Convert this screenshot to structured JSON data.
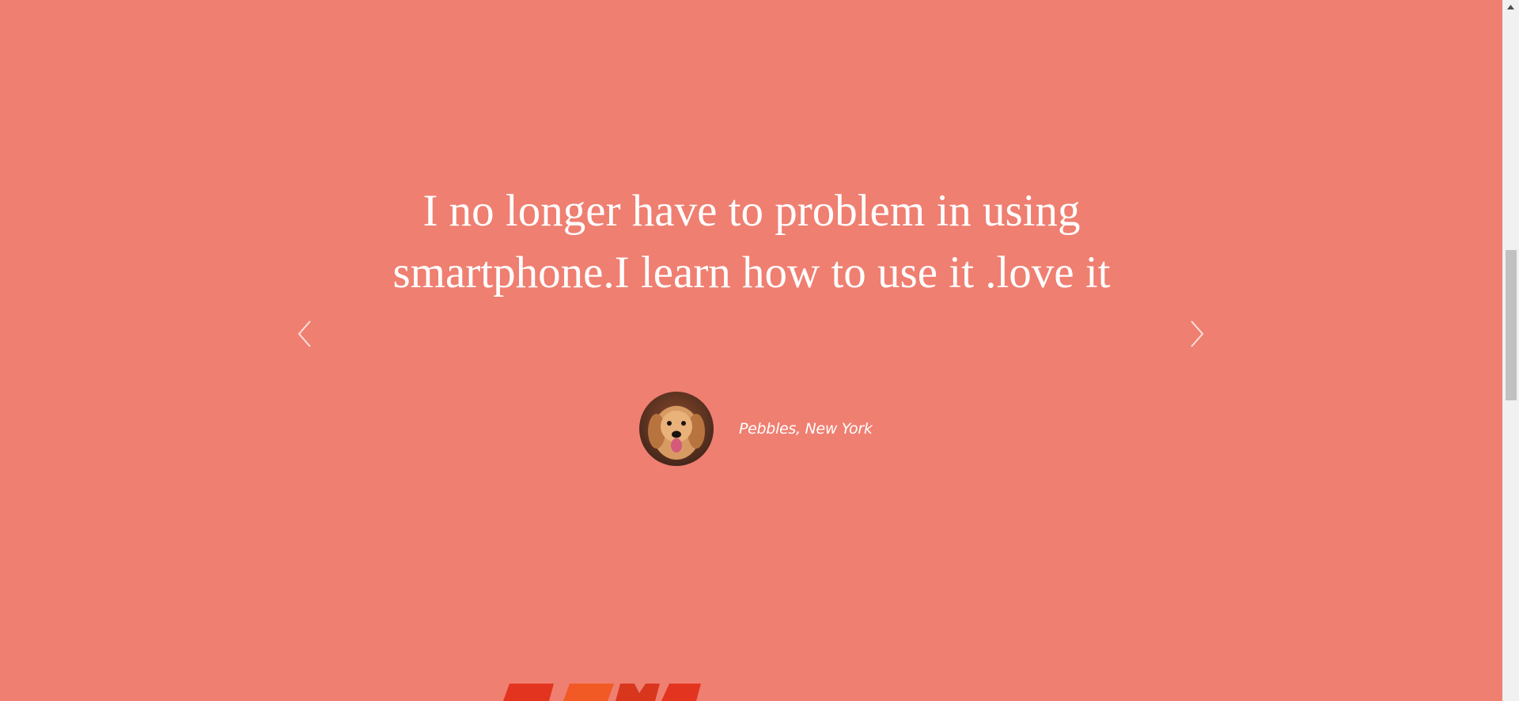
{
  "colors": {
    "background": "#ef7f71",
    "text": "#ffffff",
    "logo_orange": "#f15a24",
    "logo_red": "#e3341f"
  },
  "testimonial": {
    "quote": "I no longer have to problem in using smartphone.I learn how to use it .love it",
    "author": "Pebbles, New York",
    "avatar_alt": "golden retriever photo"
  },
  "carousel": {
    "prev_icon": "chevron-left-icon",
    "next_icon": "chevron-right-icon"
  },
  "scrollbar": {
    "up_icon": "triangle-up-icon",
    "position": 0.36
  }
}
